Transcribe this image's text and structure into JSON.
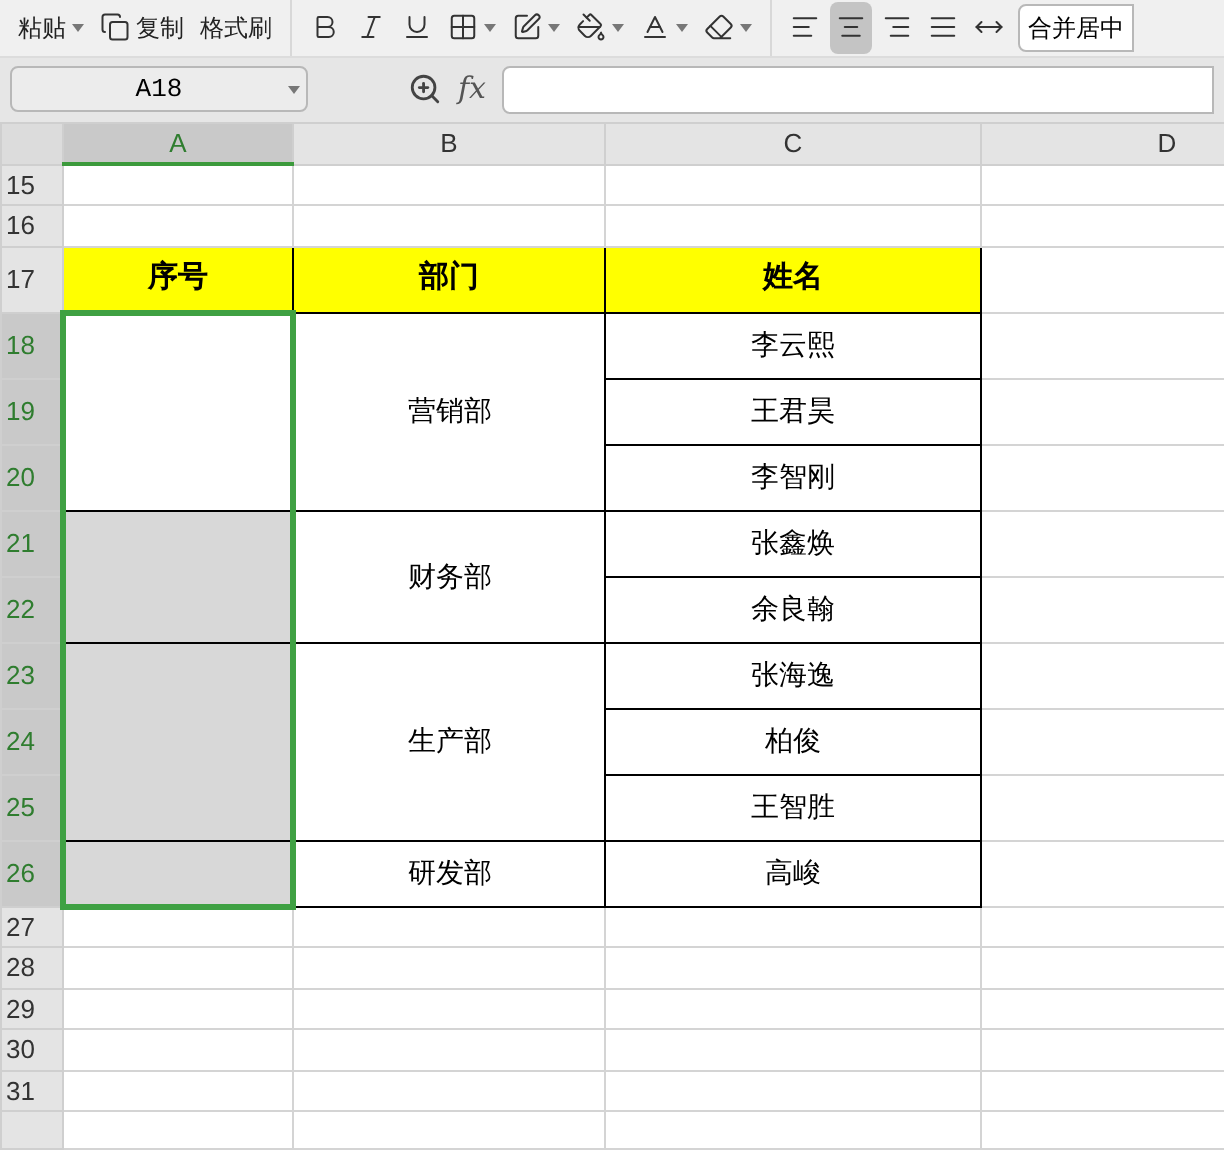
{
  "toolbar": [
    {
      "kind": "paste",
      "label": "粘贴",
      "dropdown": true,
      "selected": false
    },
    {
      "kind": "copy",
      "label": "复制",
      "dropdown": false,
      "selected": false
    },
    {
      "kind": "format-painter",
      "label": "格式刷",
      "dropdown": false,
      "selected": false
    },
    {
      "kind": "bold",
      "dropdown": false,
      "selected": false
    },
    {
      "kind": "italic",
      "dropdown": false,
      "selected": false
    },
    {
      "kind": "underline",
      "dropdown": false,
      "selected": false
    },
    {
      "kind": "borders",
      "dropdown": true,
      "selected": false
    },
    {
      "kind": "cell-style",
      "dropdown": true,
      "selected": false
    },
    {
      "kind": "fill",
      "dropdown": true,
      "selected": false
    },
    {
      "kind": "font-color",
      "dropdown": true,
      "selected": false
    },
    {
      "kind": "clear",
      "dropdown": true,
      "selected": false
    },
    {
      "kind": "align-left",
      "dropdown": false,
      "selected": false
    },
    {
      "kind": "align-center",
      "dropdown": false,
      "selected": true
    },
    {
      "kind": "align-right",
      "dropdown": false,
      "selected": false
    },
    {
      "kind": "justify",
      "dropdown": false,
      "selected": false
    },
    {
      "kind": "distribute",
      "dropdown": false,
      "selected": false
    }
  ],
  "merge_button": {
    "label": "合并居中"
  },
  "name_box": {
    "value": "A18"
  },
  "formula_bar": {
    "function_label": "fx"
  },
  "columns": [
    {
      "label": "A",
      "selected": true
    },
    {
      "label": "B",
      "selected": false
    },
    {
      "label": "C",
      "selected": false
    },
    {
      "label": "D",
      "selected": false
    }
  ],
  "row_headers": [
    {
      "label": "15",
      "selected": false
    },
    {
      "label": "16",
      "selected": false
    },
    {
      "label": "17",
      "selected": false
    },
    {
      "label": "18",
      "selected": true
    },
    {
      "label": "19",
      "selected": true
    },
    {
      "label": "20",
      "selected": true
    },
    {
      "label": "21",
      "selected": true
    },
    {
      "label": "22",
      "selected": true
    },
    {
      "label": "23",
      "selected": true
    },
    {
      "label": "24",
      "selected": true
    },
    {
      "label": "25",
      "selected": true
    },
    {
      "label": "26",
      "selected": true
    },
    {
      "label": "27",
      "selected": false
    },
    {
      "label": "28",
      "selected": false
    },
    {
      "label": "29",
      "selected": false
    },
    {
      "label": "30",
      "selected": false
    },
    {
      "label": "31",
      "selected": false
    }
  ],
  "table": {
    "headers": [
      "序号",
      "部门",
      "姓名"
    ],
    "groups": [
      {
        "department": "营销部",
        "names": [
          "李云熙",
          "王君昊",
          "李智刚"
        ],
        "selected": true,
        "active": true
      },
      {
        "department": "财务部",
        "names": [
          "张鑫焕",
          "余良翰"
        ],
        "selected": true,
        "active": false
      },
      {
        "department": "生产部",
        "names": [
          "张海逸",
          "柏俊",
          "王智胜"
        ],
        "selected": true,
        "active": false
      },
      {
        "department": "研发部",
        "names": [
          "高峻"
        ],
        "selected": true,
        "active": false
      }
    ]
  }
}
